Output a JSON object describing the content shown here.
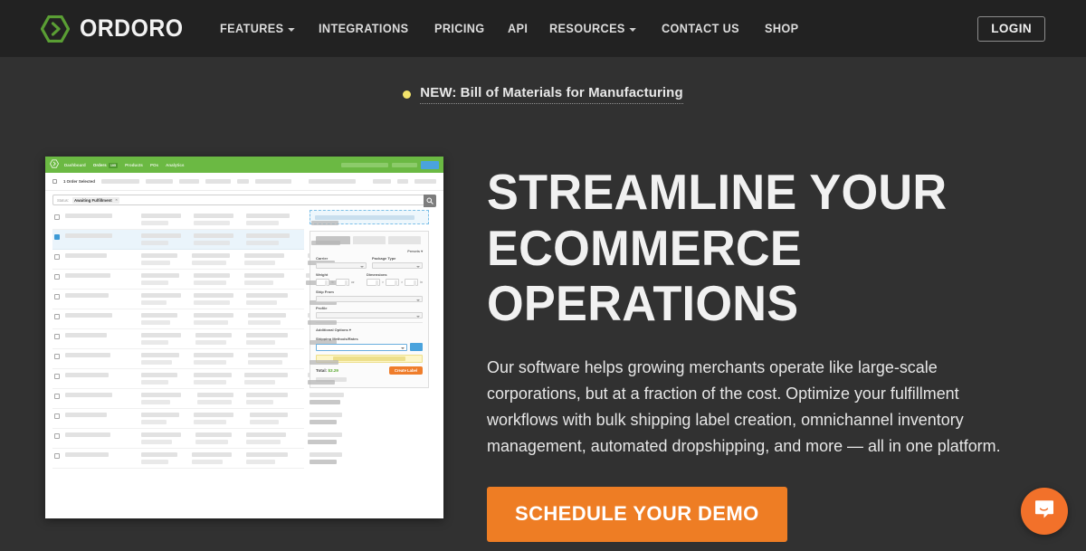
{
  "nav": {
    "logo_icon": "ordoro-hexagon-chevron-icon",
    "brand": "ORDORO",
    "items": [
      {
        "label": "FEATURES",
        "has_caret": true
      },
      {
        "label": "INTEGRATIONS",
        "has_caret": false
      },
      {
        "label": "PRICING",
        "has_caret": false
      },
      {
        "label": "API",
        "has_caret": false
      },
      {
        "label": "RESOURCES",
        "has_caret": true
      },
      {
        "label": "CONTACT US",
        "has_caret": false
      },
      {
        "label": "SHOP",
        "has_caret": false
      }
    ],
    "login_label": "LOGIN"
  },
  "announcement": {
    "dot_color": "#f2e36b",
    "text": "NEW: Bill of Materials for Manufacturing"
  },
  "hero": {
    "headline_line1": "STREAMLINE YOUR",
    "headline_line2": "ECOMMERCE OPERATIONS",
    "paragraph": "Our software helps growing merchants operate like large-scale corporations, but at a fraction of the cost. Optimize your fulfillment workflows with bulk shipping label creation, omnichannel inventory management, automated dropshipping, and more — all in one platform.",
    "cta_label": "SCHEDULE YOUR DEMO",
    "cta_color": "#ee7d24"
  },
  "app_screenshot": {
    "header": {
      "logo_icon": "ordoro-hexagon-icon",
      "accent_color": "#6bb943",
      "tabs": [
        {
          "label": "Dashboard",
          "active": false,
          "badge": ""
        },
        {
          "label": "Orders",
          "active": true,
          "badge": "105"
        },
        {
          "label": "Products",
          "active": false,
          "badge": ""
        },
        {
          "label": "POs",
          "active": false,
          "badge": ""
        },
        {
          "label": "Analytics",
          "active": false,
          "badge": ""
        }
      ]
    },
    "subbar": {
      "selection_label": "1 Order Selected"
    },
    "filter": {
      "key_label": "Status:",
      "chip_label": "Awaiting Fulfillment",
      "chip_remove_icon": "close-icon",
      "search_icon": "search-icon"
    },
    "orders": {
      "rows": [
        {
          "selected": false
        },
        {
          "selected": true
        },
        {
          "selected": false
        },
        {
          "selected": false
        },
        {
          "selected": false
        },
        {
          "selected": false
        },
        {
          "selected": false
        },
        {
          "selected": false
        },
        {
          "selected": false
        },
        {
          "selected": false
        },
        {
          "selected": false
        },
        {
          "selected": false
        },
        {
          "selected": false
        }
      ]
    },
    "ship_panel": {
      "tabs_count": 3,
      "presets_label": "Presets",
      "presets_caret_icon": "chevron-down-icon",
      "carrier_label": "Carrier",
      "package_type_label": "Package Type",
      "weight_label": "Weight",
      "weight_unit": "lb",
      "weight_unit2": "oz",
      "dimensions_label": "Dimensions",
      "dimensions_unit": "in",
      "ship_from_label": "Ship From",
      "profile_label": "Profile",
      "additional_options_label": "Additional Options",
      "additional_options_caret_icon": "chevron-down-icon",
      "shipping_methods_label": "Shipping Methods/Rates",
      "total_label": "Total:",
      "total_amount": "$3.29",
      "total_amount_color": "#5aa82f",
      "create_label_button": "Create Label",
      "create_label_color": "#ef7d2b"
    }
  },
  "chat": {
    "launcher_icon": "chat-bubble-icon",
    "launcher_color": "#f2712a"
  }
}
